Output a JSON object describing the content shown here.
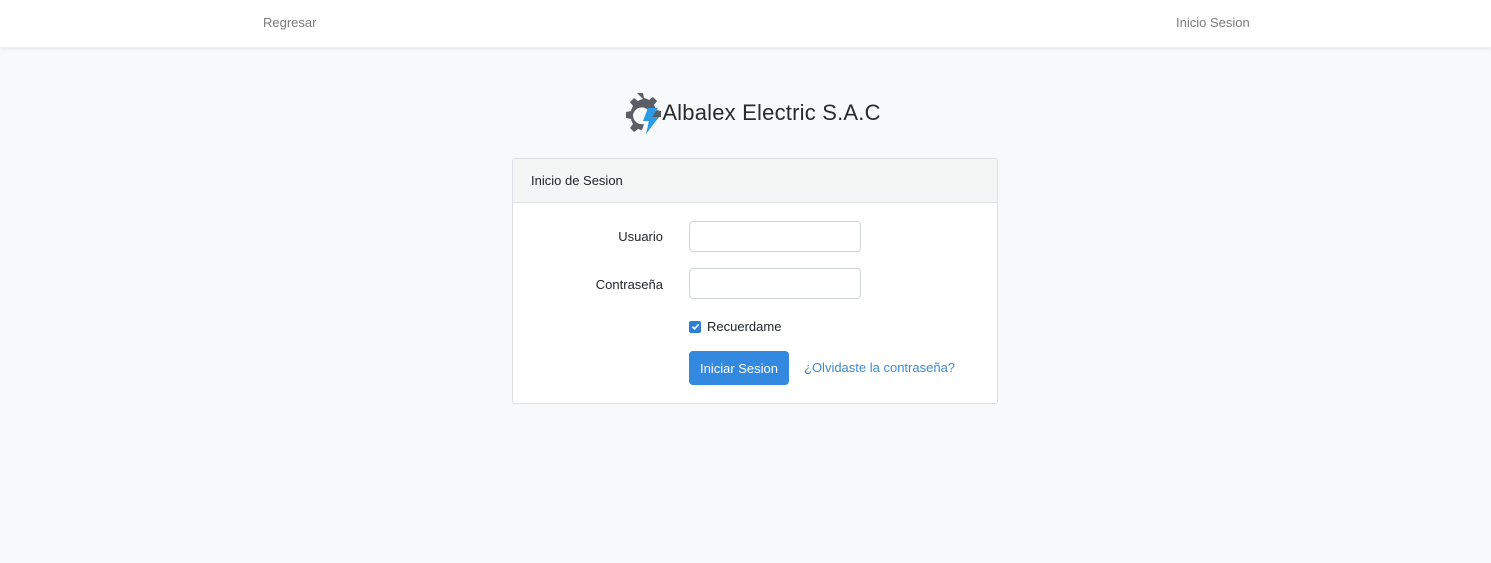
{
  "nav": {
    "back_label": "Regresar",
    "login_label": "Inicio Sesion"
  },
  "brand": {
    "name": "Albalex Electric S.A.C",
    "logo_icon": "gear-lightning-logo",
    "colors": {
      "gear": "#5a5f66",
      "bolt": "#2b9be8"
    }
  },
  "login_card": {
    "header": "Inicio de Sesion",
    "username_label": "Usuario",
    "username_value": "",
    "password_label": "Contraseña",
    "password_value": "",
    "remember_label": "Recuerdame",
    "remember_checked": true,
    "submit_label": "Iniciar Sesion",
    "forgot_label": "¿Olvidaste la contraseña?"
  },
  "colors": {
    "primary": "#3389e0",
    "link": "#3a8ad8",
    "background": "#f8f9fb"
  }
}
